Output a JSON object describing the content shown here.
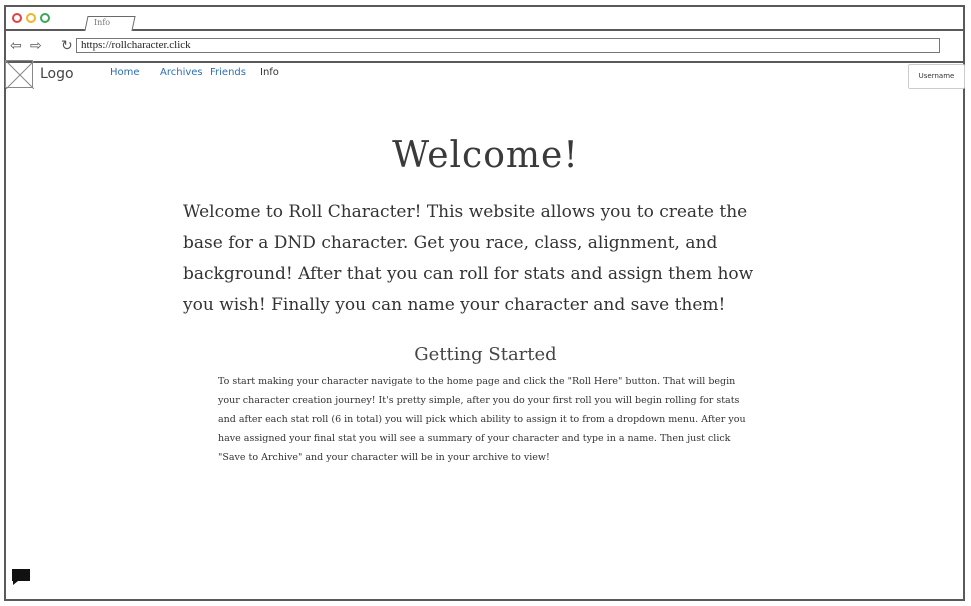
{
  "browser": {
    "tab_title": "Info",
    "url": "https://rollcharacter.click",
    "back_icon": "arrow-left-icon",
    "forward_icon": "arrow-right-icon",
    "reload_icon": "reload-icon"
  },
  "nav": {
    "logo": "Logo",
    "links": [
      "Home",
      "Archives",
      "Friends",
      "Info"
    ],
    "user_button": "Username"
  },
  "main": {
    "title": "Welcome!",
    "intro": "Welcome to Roll Character! This website allows you to create the base for a DND character. Get you race, class, alignment, and background! After that you can roll for stats and assign them how you wish! Finally you can name your character and save them!",
    "section_title": "Getting Started",
    "section_body": "To start making your character navigate to the home page and click the \"Roll Here\" button. That will begin your character creation journey! It's pretty simple, after you do your first roll you will begin rolling for stats and after each stat roll (6 in total) you will pick which ability to assign it to from a dropdown menu. After you have assigned your final stat you will see a summary of your character and type in a name. Then just click \"Save to Archive\" and your character will be in your archive to view!"
  },
  "chat": {
    "icon": "chat-bubble-icon"
  }
}
